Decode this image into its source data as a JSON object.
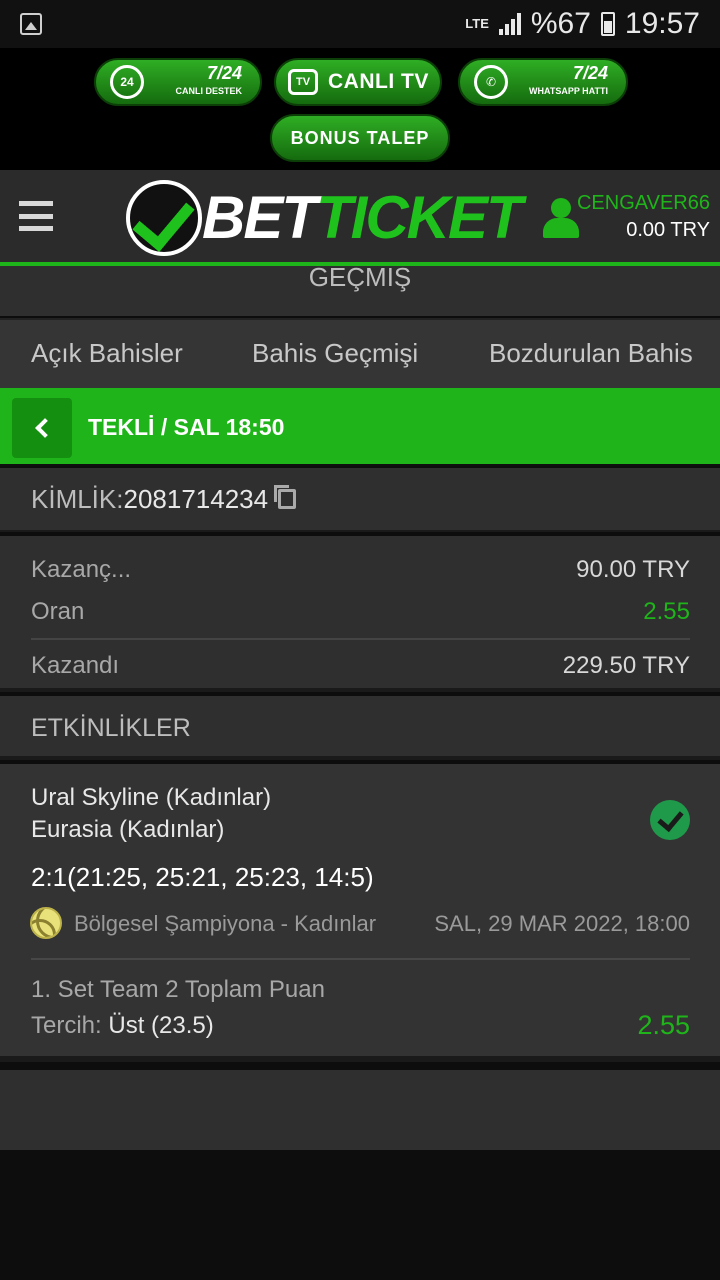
{
  "status_bar": {
    "network": "LTE",
    "battery": "%67",
    "time": "19:57"
  },
  "promo": {
    "support": {
      "hours": "7/24",
      "label": "CANLI DESTEK",
      "icon_text": "24"
    },
    "tv": {
      "label": "CANLI TV",
      "icon_text": "TV"
    },
    "whatsapp": {
      "hours": "7/24",
      "label": "WHATSAPP HATTI"
    },
    "bonus": {
      "label": "BONUS TALEP"
    }
  },
  "header": {
    "logo_part1": "BET",
    "logo_part2": "TICKET",
    "username": "CENGAVER66",
    "balance": "0.00 TRY"
  },
  "section": {
    "title": "GEÇMİŞ"
  },
  "tabs": [
    {
      "label": "Açık Bahisler"
    },
    {
      "label": "Bahis Geçmişi"
    },
    {
      "label": "Bozdurulan Bahis"
    }
  ],
  "bet": {
    "type_label": "TEKLİ / SAL 18:50",
    "id_label": "KİMLİK:",
    "id_value": "2081714234",
    "summary": {
      "winnings_label": "Kazanç...",
      "winnings_value": "90.00 TRY",
      "odds_label": "Oran",
      "odds_value": "2.55",
      "won_label": "Kazandı",
      "won_value": "229.50 TRY"
    }
  },
  "events": {
    "header": "ETKİNLİKLER",
    "items": [
      {
        "team1": "Ural Skyline (Kadınlar)",
        "team2": "Eurasia (Kadınlar)",
        "score": "2:1(21:25, 25:21, 25:23, 14:5)",
        "league": "Bölgesel Şampiyona - Kadınlar",
        "date": "SAL, 29 MAR 2022, 18:00",
        "market": "1. Set Team 2 Toplam Puan",
        "pick_label": "Tercih:",
        "pick_value": "Üst (23.5)",
        "odd": "2.55"
      }
    ]
  },
  "colors": {
    "accent_green": "#1fb51a",
    "header_bg": "#2b2b2b",
    "panel_bg": "#2f2f2f"
  }
}
